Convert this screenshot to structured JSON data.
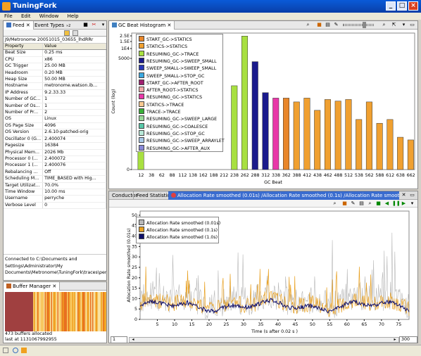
{
  "window": {
    "title": "TuningFork",
    "min": "_",
    "max": "□",
    "close": "×"
  },
  "menu": [
    "File",
    "Edit",
    "Window",
    "Help"
  ],
  "left_panel": {
    "tabs": [
      "Feed",
      "Event Types"
    ],
    "tab2_suffix": "»2",
    "path": "J9/Metronome 20051015_03655_lhdRRr",
    "columns": [
      "Property",
      "Value"
    ],
    "rows": [
      [
        "Beat Size",
        "0.25 ms"
      ],
      [
        "CPU",
        "x86"
      ],
      [
        "GC Trigger",
        "25.00 MB"
      ],
      [
        "Headroom",
        "0.20 MB"
      ],
      [
        "Heap Size",
        "50.00 MB"
      ],
      [
        "Hostname",
        "metronome.watson.ib..."
      ],
      [
        "IP Address",
        "9.2.33.33"
      ],
      [
        "Number of GC...",
        "1"
      ],
      [
        "Number of Os...",
        "1"
      ],
      [
        "Number of Pr...",
        "2"
      ],
      [
        "OS",
        "Linux"
      ],
      [
        "OS Page Size",
        "4096"
      ],
      [
        "OS Version",
        "2.6.10-patched-orig"
      ],
      [
        "Oscillator 0 (G...",
        "2.400074"
      ],
      [
        "Pagesize",
        "16384"
      ],
      [
        "Physical Mem...",
        "2026 Mb"
      ],
      [
        "Processor 0 (...",
        "2.400072"
      ],
      [
        "Processor 1 (...",
        "2.400076"
      ],
      [
        "Rebalancing ...",
        "Off"
      ],
      [
        "Scheduling M...",
        "TIME_BASED with Hig..."
      ],
      [
        "Target Utilizat...",
        "70.0%"
      ],
      [
        "Time Window",
        "10.00 ms"
      ],
      [
        "Username",
        "perryche"
      ],
      [
        "Verbose Level",
        "0"
      ]
    ],
    "connection_lines": [
      "Connected to C:\\Documents and",
      "Settings\\Administrator\\My",
      "Documents\\Metronome\\TuningFork\\traces\\perr"
    ]
  },
  "buffer_panel": {
    "tab": "Buffer Manager",
    "line1": "473 buffers allocated",
    "line2": "last at 1131067992955"
  },
  "histogram": {
    "tab": "GC Beat Histogram",
    "y_ticks": [
      "2.5E",
      "1.5E",
      "1E4",
      "5000",
      "0"
    ],
    "ylabel": "Count (log)",
    "xlabel": "GC Beat",
    "legend": [
      {
        "label": "START_GC->STATICS",
        "color": "#e8862a"
      },
      {
        "label": "STATICS->STATICS",
        "color": "#f0a030"
      },
      {
        "label": "RESUMING_GC->TRACE",
        "color": "#a8e040"
      },
      {
        "label": "RESUMING_GC->SWEEP_SMALL",
        "color": "#1a1a8c"
      },
      {
        "label": "SWEEP_SMALL->SWEEP_SMALL",
        "color": "#2838b8"
      },
      {
        "label": "SWEEP_SMALL->STOP_GC",
        "color": "#3aa8e0"
      },
      {
        "label": "START_GC->AFTER_ROOT",
        "color": "#a02070"
      },
      {
        "label": "AFTER_ROOT->STATICS",
        "color": "#f0a8a8"
      },
      {
        "label": "RESUMING_GC->STATICS",
        "color": "#e838a8"
      },
      {
        "label": "STATICS->TRACE",
        "color": "#f8c890"
      },
      {
        "label": "TRACE->TRACE",
        "color": "#38b038"
      },
      {
        "label": "RESUMING_GC->SWEEP_LARGE",
        "color": "#98d898"
      },
      {
        "label": "RESUMING_GC->COALESCE",
        "color": "#58c8a8"
      },
      {
        "label": "RESUMING_GC->STOP_GC",
        "color": "#b8e8d8"
      },
      {
        "label": "RESUMING_GC->SWEEP_ARRAYLET",
        "color": "#a8c8e8"
      },
      {
        "label": "RESUMING_GC->AFTER_AUX",
        "color": "#8888d8"
      }
    ]
  },
  "lower_panel": {
    "tabs": [
      "Conductor",
      "Feed Statistics",
      "Allocation Rate smoothed (0.01s) /Allocation Rate smoothed (0.1s) /Allocation Rate smoothed (1.0s..."
    ],
    "page_value": "1",
    "zoom_value": "300"
  },
  "chart_data": [
    {
      "type": "bar",
      "title": "",
      "xlabel": "GC Beat",
      "ylabel": "Count (log)",
      "log_scale": true,
      "categories": [
        "12",
        "38",
        "62",
        "88",
        "112",
        "138",
        "162",
        "188",
        "212",
        "238",
        "262",
        "288",
        "312",
        "338",
        "362",
        "388",
        "412",
        "438",
        "462",
        "488",
        "512",
        "538",
        "562",
        "588",
        "612",
        "638",
        "662"
      ],
      "series": [
        {
          "name": "START_GC->STATICS",
          "values": [
            0,
            0,
            0,
            0,
            0,
            0,
            0,
            0,
            0,
            0,
            0,
            0,
            0,
            0,
            200,
            0,
            0,
            0,
            0,
            0,
            0,
            0,
            0,
            0,
            0,
            0,
            0
          ]
        },
        {
          "name": "STATICS->STATICS",
          "values": [
            0,
            0,
            0,
            0,
            0,
            0,
            0,
            0,
            0,
            0,
            0,
            0,
            0,
            0,
            0,
            150,
            200,
            80,
            180,
            160,
            180,
            40,
            150,
            30,
            40,
            10,
            8
          ]
        },
        {
          "name": "RESUMING_GC->TRACE",
          "values": [
            80,
            0,
            0,
            0,
            0,
            0,
            0,
            0,
            0,
            500,
            20000,
            0,
            0,
            0,
            0,
            0,
            0,
            0,
            0,
            0,
            0,
            0,
            0,
            0,
            0,
            0,
            0
          ]
        },
        {
          "name": "RESUMING_GC->SWEEP_SMALL",
          "values": [
            0,
            0,
            0,
            0,
            0,
            0,
            0,
            0,
            0,
            0,
            0,
            3000,
            300,
            0,
            0,
            0,
            0,
            0,
            0,
            0,
            0,
            0,
            0,
            0,
            0,
            0,
            0
          ]
        },
        {
          "name": "RESUMING_GC->STATICS",
          "values": [
            0,
            0,
            0,
            0,
            0,
            0,
            0,
            0,
            0,
            0,
            0,
            0,
            0,
            200,
            0,
            0,
            0,
            0,
            0,
            0,
            0,
            0,
            0,
            0,
            0,
            0,
            0
          ]
        }
      ],
      "ylim": [
        0,
        25000
      ]
    },
    {
      "type": "line",
      "title": "",
      "xlabel": "Time (s  after 0.02 s )",
      "ylabel": "Allocation Rate smoothed (0.01s)",
      "x_ticks": [
        5,
        10,
        15,
        20,
        25,
        30,
        35,
        40,
        45,
        50,
        55,
        60,
        65,
        70,
        75
      ],
      "y_ticks": [
        0,
        5,
        10,
        15,
        20,
        25,
        30,
        35,
        40,
        45,
        50
      ],
      "ylim": [
        0,
        52
      ],
      "xlim": [
        0,
        78
      ],
      "series": [
        {
          "name": "Allocation Rate smoothed (0.01s)",
          "color": "#b8b8b8",
          "mean": 7.0
        },
        {
          "name": "Allocation Rate smoothed (0.1s)",
          "color": "#e8a020",
          "mean": 7.0
        },
        {
          "name": "Allocation Rate smoothed (1.0s)",
          "color": "#10106a",
          "mean": 6.5
        }
      ]
    }
  ]
}
